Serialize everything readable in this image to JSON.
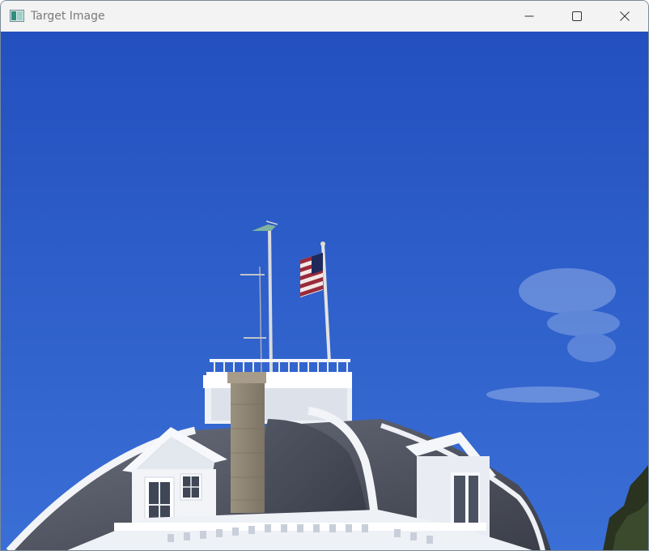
{
  "window": {
    "title": "Target Image",
    "icon": "image-window-icon",
    "controls": [
      {
        "name": "minimize-button",
        "icon": "minimize-icon"
      },
      {
        "name": "maximize-button",
        "icon": "maximize-icon"
      },
      {
        "name": "close-button",
        "icon": "close-icon"
      }
    ]
  },
  "image": {
    "subject": "photo",
    "colors": {
      "sky_top": "#2350bf",
      "sky_bottom": "#3a6fd6",
      "roof": "#4b4f5c",
      "trim": "#f4f6fa",
      "chimney": "#8f8575"
    }
  }
}
